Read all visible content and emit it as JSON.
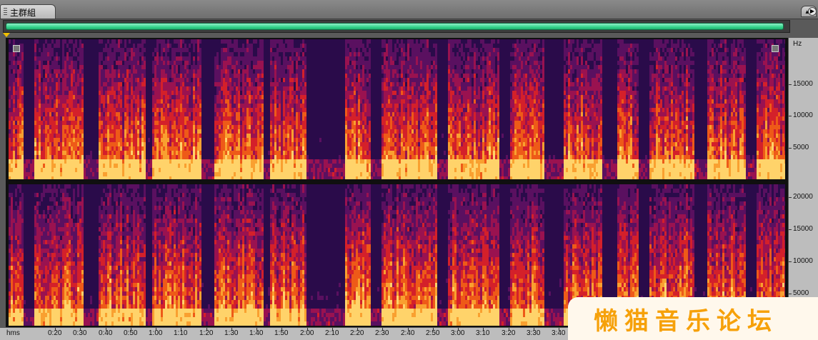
{
  "tab": {
    "label": "主群組",
    "menu_icon": "tab-menu-icon"
  },
  "nav": {
    "arrow_icon": "play-right-icon"
  },
  "overview": {
    "visible_fraction": 0.995
  },
  "freq_axis": {
    "unit": "Hz",
    "ch1_ticks": [
      "15000",
      "10000",
      "5000"
    ],
    "ch2_ticks": [
      "20000",
      "15000",
      "10000",
      "5000"
    ],
    "max_hz": 22050
  },
  "time_axis": {
    "unit": "hms",
    "ticks": [
      "0:20",
      "0:30",
      "0:40",
      "0:50",
      "1:00",
      "1:10",
      "1:20",
      "1:30",
      "1:40",
      "1:50",
      "2:00",
      "2:10",
      "2:20",
      "2:30",
      "2:40",
      "2:50",
      "3:00",
      "3:10",
      "3:20",
      "3:30",
      "3:40"
    ]
  },
  "watermark": {
    "text": "懒猫音乐论坛"
  },
  "colors": {
    "overview_fill": "#35d38c",
    "spectrum_low": "#2a0b4a",
    "spectrum_mid": "#d4202a",
    "spectrum_high": "#ffd36a",
    "watermark": "#f6a10a"
  }
}
